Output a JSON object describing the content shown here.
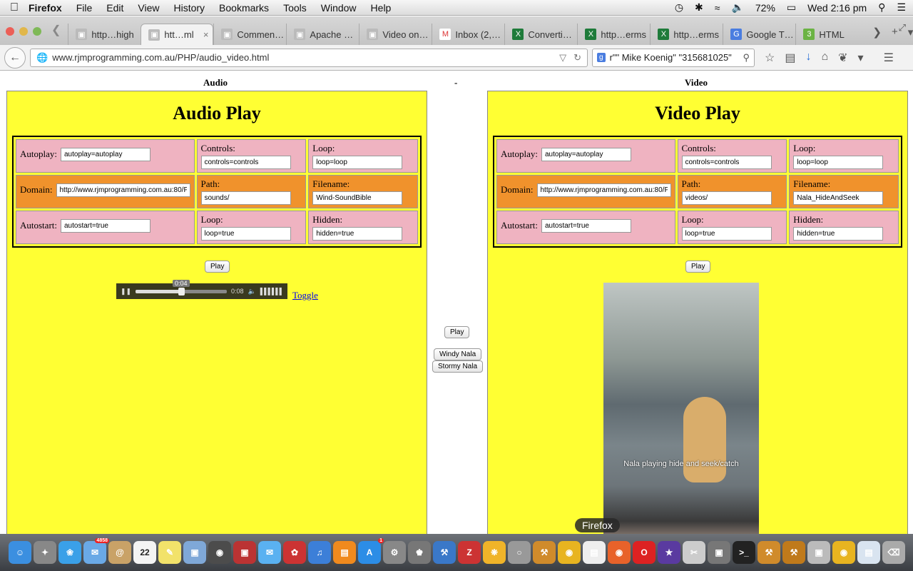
{
  "menubar": {
    "app": "Firefox",
    "items": [
      "File",
      "Edit",
      "View",
      "History",
      "Bookmarks",
      "Tools",
      "Window",
      "Help"
    ],
    "battery": "72%",
    "clock": "Wed 2:16 pm"
  },
  "tabs": [
    {
      "label": "http…high"
    },
    {
      "label": "htt…ml",
      "active": true
    },
    {
      "label": "Commen…"
    },
    {
      "label": "Apache …"
    },
    {
      "label": "Video on…"
    },
    {
      "label": "Inbox (2,…"
    },
    {
      "label": "Converti…"
    },
    {
      "label": "http…erms"
    },
    {
      "label": "http…erms"
    },
    {
      "label": "Google T…"
    },
    {
      "label": "HTML"
    }
  ],
  "tab_icons": [
    "page",
    "page",
    "page",
    "page",
    "page",
    "gmail",
    "x",
    "x",
    "x",
    "translate",
    "w3"
  ],
  "nav": {
    "url": "www.rjmprogramming.com.au/PHP/audio_video.html",
    "search": "r\"\" Mike Koenig\" \"315681025\""
  },
  "page": {
    "audio_heading": "Audio",
    "middle_heading": "-",
    "video_heading": "Video",
    "audio": {
      "title": "Audio Play",
      "autoplay_label": "Autoplay:",
      "autoplay_value": "autoplay=autoplay",
      "controls_label": "Controls:",
      "controls_value": "controls=controls",
      "loop_label": "Loop:",
      "loop_value": "loop=loop",
      "domain_label": "Domain:",
      "domain_value": "http://www.rjmprogramming.com.au:80/PHP/",
      "path_label": "Path:",
      "path_value": "sounds/",
      "filename_label": "Filename:",
      "filename_value": "Wind-SoundBible",
      "autostart_label": "Autostart:",
      "autostart_value": "autostart=true",
      "loop2_label": "Loop:",
      "loop2_value": "loop=true",
      "hidden_label": "Hidden:",
      "hidden_value": "hidden=true",
      "play_label": "Play",
      "current_time": "0:04",
      "duration": "0:08",
      "progress": 0.5,
      "toggle_label": "Toggle"
    },
    "middle": {
      "play_label": "Play",
      "windy_label": "Windy Nala",
      "stormy_label": "Stormy Nala"
    },
    "video": {
      "title": "Video Play",
      "autoplay_label": "Autoplay:",
      "autoplay_value": "autoplay=autoplay",
      "controls_label": "Controls:",
      "controls_value": "controls=controls",
      "loop_label": "Loop:",
      "loop_value": "loop=loop",
      "domain_label": "Domain:",
      "domain_value": "http://www.rjmprogramming.com.au:80/PHP/",
      "path_label": "Path:",
      "path_value": "videos/",
      "filename_label": "Filename:",
      "filename_value": "Nala_HideAndSeek",
      "autostart_label": "Autostart:",
      "autostart_value": "autostart=true",
      "loop2_label": "Loop:",
      "loop2_value": "loop=true",
      "hidden_label": "Hidden:",
      "hidden_value": "hidden=true",
      "play_label": "Play",
      "caption": "Nala playing hide and seek/catch"
    }
  },
  "dock": {
    "tooltip": "Firefox",
    "mail_badge": "4858",
    "calendar_day": "22",
    "appstore_badge": "1"
  },
  "colors": {
    "panel": "#ffff33",
    "pink": "#efb3c1",
    "orange": "#f0922c"
  }
}
